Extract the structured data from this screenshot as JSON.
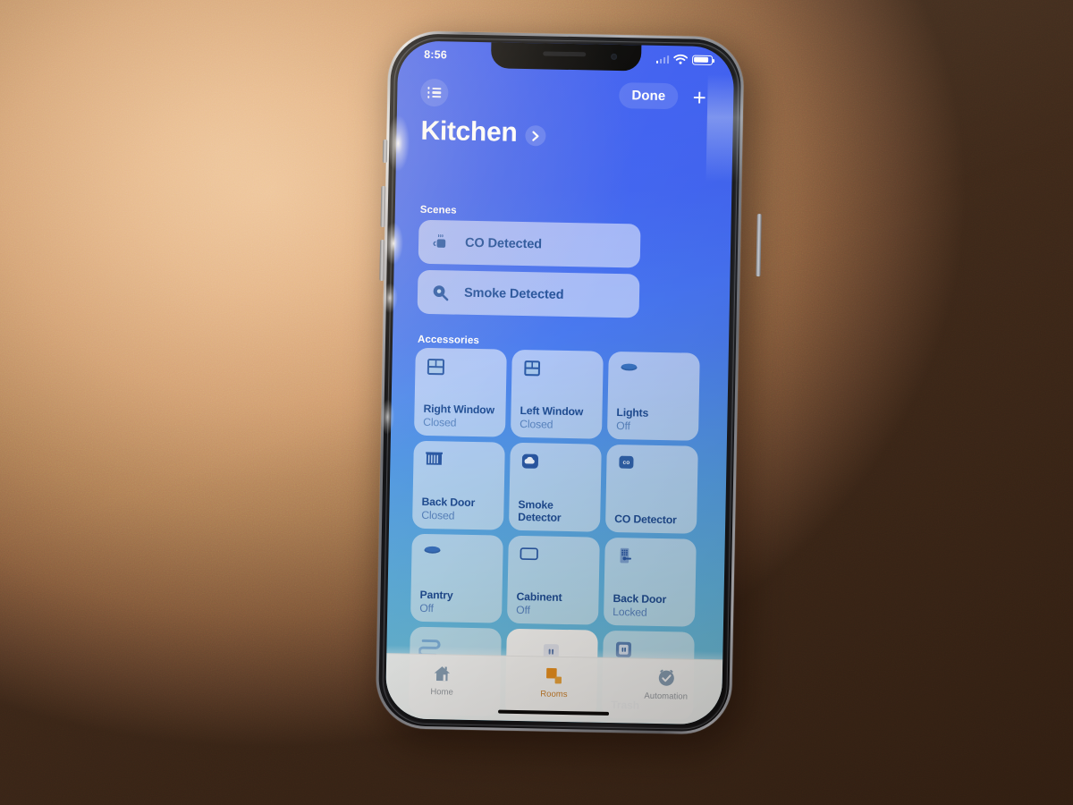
{
  "device": {
    "type": "smartphone",
    "orientation": "portrait"
  },
  "status_bar": {
    "time": "8:56",
    "cellular_icon": "signal-bars-icon",
    "wifi_icon": "wifi-icon",
    "battery_icon": "battery-icon"
  },
  "nav": {
    "list_icon": "list-icon",
    "done_label": "Done",
    "add_label": "+",
    "add_icon": "plus-icon"
  },
  "header": {
    "room_name": "Kitchen",
    "chevron_icon": "chevron-right-icon"
  },
  "sections": {
    "scenes_label": "Scenes",
    "accessories_label": "Accessories"
  },
  "scenes": [
    {
      "name": "CO Detected",
      "icon": "coffee-mug-icon"
    },
    {
      "name": "Smoke Detected",
      "icon": "frying-pan-icon"
    }
  ],
  "accessories": [
    {
      "name": "Right Window",
      "state": "Closed",
      "icon": "window-icon",
      "active": false
    },
    {
      "name": "Left Window",
      "state": "Closed",
      "icon": "window-icon",
      "active": false
    },
    {
      "name": "Lights",
      "state": "Off",
      "icon": "ceiling-light-icon",
      "active": false
    },
    {
      "name": "Back Door",
      "state": "Closed",
      "icon": "blinds-icon",
      "active": false
    },
    {
      "name": "Smoke Detector",
      "state": "",
      "icon": "smoke-cloud-icon",
      "active": false
    },
    {
      "name": "CO Detector",
      "state": "",
      "icon": "co-badge-icon",
      "active": false
    },
    {
      "name": "Pantry",
      "state": "Off",
      "icon": "ceiling-light-icon",
      "active": false
    },
    {
      "name": "Cabinent",
      "state": "Off",
      "icon": "cabinet-icon",
      "active": false
    },
    {
      "name": "Back Door",
      "state": "Locked",
      "icon": "keypad-lock-icon",
      "active": false
    },
    {
      "name": "",
      "state": "",
      "icon": "hose-icon",
      "active": false
    },
    {
      "name": "",
      "state": "",
      "icon": "outlet-icon",
      "active": true
    },
    {
      "name": "Trash",
      "state": "",
      "icon": "outlet-icon",
      "active": false
    }
  ],
  "tabs": [
    {
      "label": "Home",
      "icon": "house-icon",
      "selected": false
    },
    {
      "label": "Rooms",
      "icon": "rooms-squares-icon",
      "selected": true
    },
    {
      "label": "Automation",
      "icon": "clock-check-icon",
      "selected": false
    }
  ],
  "colors": {
    "screen_top": "#3a5bf2",
    "screen_bottom": "#74cbe2",
    "tile_text": "#1f4e96",
    "tile_state_text": "#5a87c4",
    "accent_orange": "#f0921f",
    "wall_light": "#e8b98c",
    "wall_dark": "#3d2819"
  }
}
